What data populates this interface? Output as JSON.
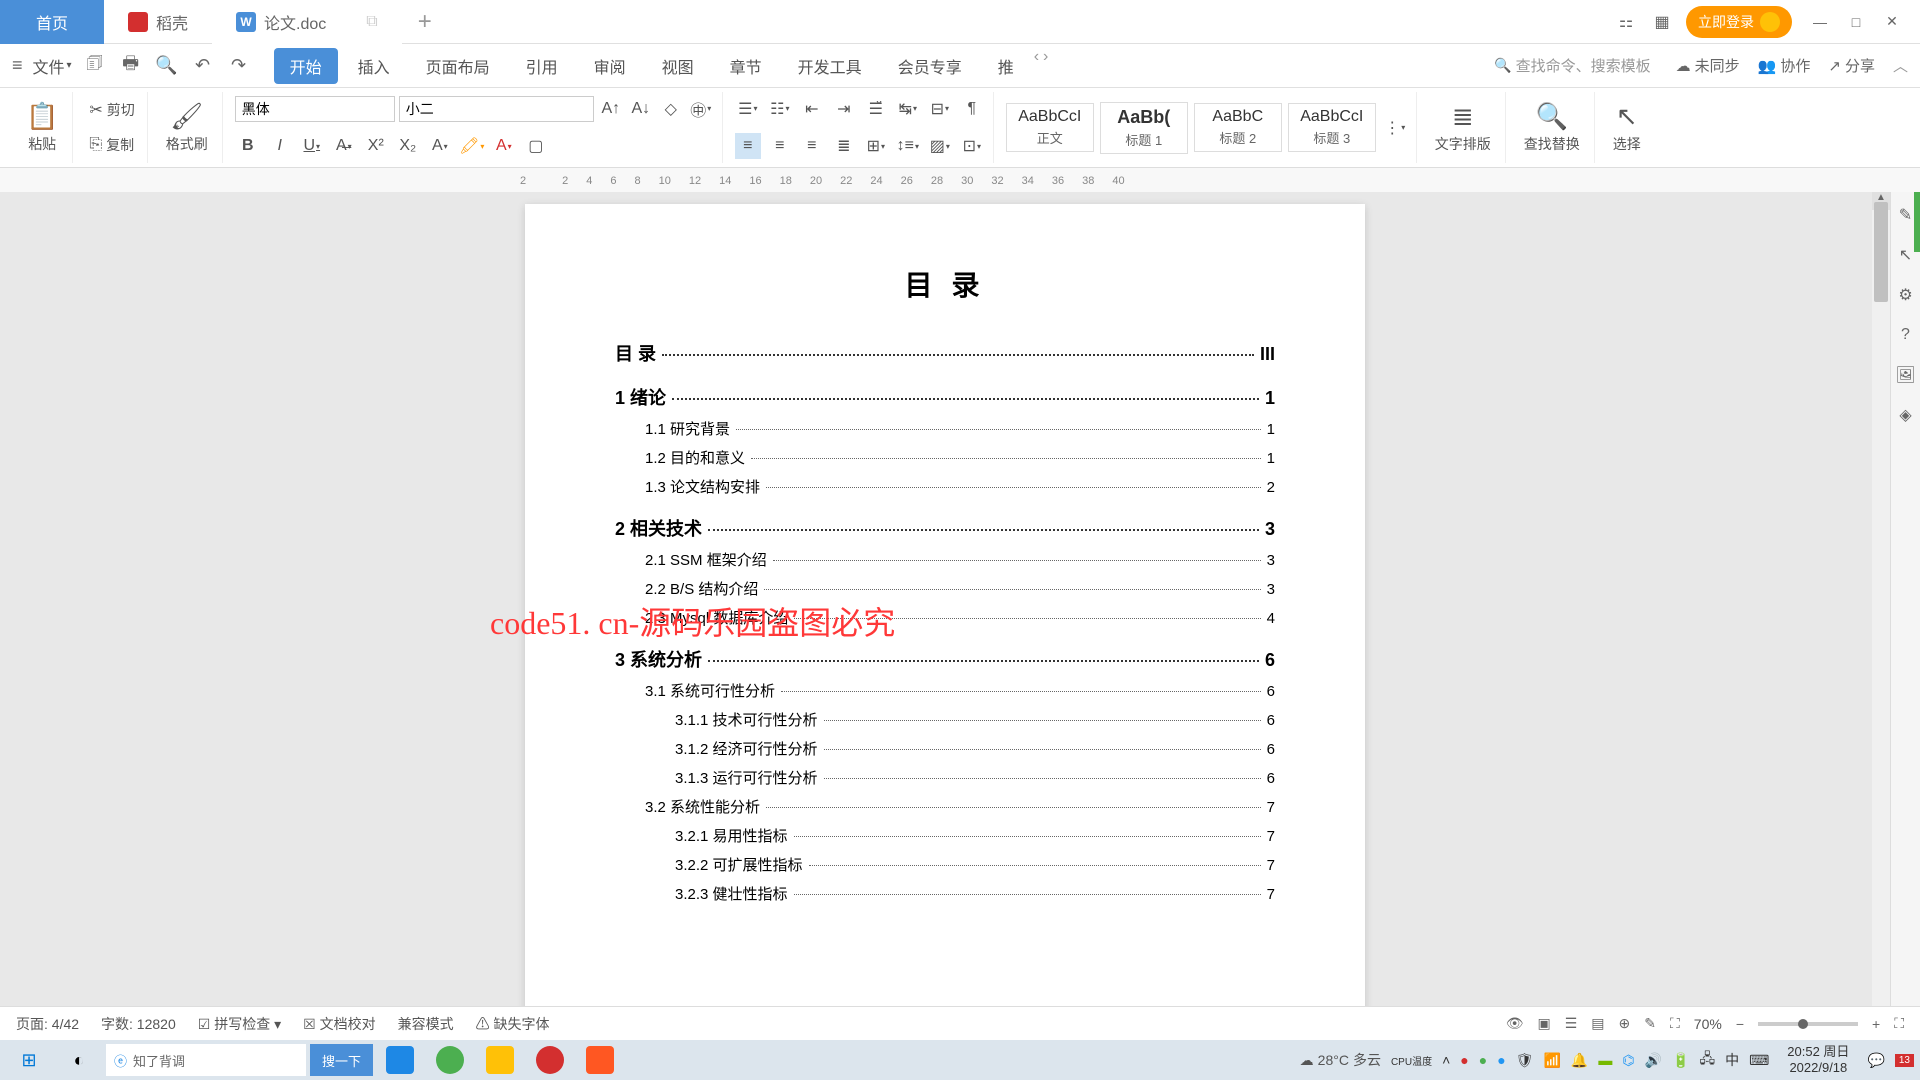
{
  "tabs": {
    "home": "首页",
    "daoke": "稻壳",
    "doc": "论文.doc"
  },
  "login_btn": "立即登录",
  "file_menu": "文件",
  "qat": {
    "save": "💾",
    "print": "🖨",
    "preview": "🔍",
    "undo": "↶",
    "redo": "↷"
  },
  "menu": [
    "开始",
    "插入",
    "页面布局",
    "引用",
    "审阅",
    "视图",
    "章节",
    "开发工具",
    "会员专享",
    "推"
  ],
  "search_cmd": "查找命令、搜索模板",
  "menu_right": {
    "sync": "未同步",
    "collab": "协作",
    "share": "分享"
  },
  "ribbon": {
    "paste": "粘贴",
    "cut": "剪切",
    "copy": "复制",
    "format_painter": "格式刷",
    "font_name": "黑体",
    "font_size": "小二",
    "styles": [
      {
        "preview": "AaBbCcI",
        "label": "正文"
      },
      {
        "preview": "AaBb(",
        "label": "标题 1"
      },
      {
        "preview": "AaBbC",
        "label": "标题 2"
      },
      {
        "preview": "AaBbCcI",
        "label": "标题 3"
      }
    ],
    "text_layout": "文字排版",
    "find_replace": "查找替换",
    "select": "选择"
  },
  "ruler_marks": [
    "2",
    "",
    "2",
    "4",
    "6",
    "8",
    "10",
    "12",
    "14",
    "16",
    "18",
    "20",
    "22",
    "24",
    "26",
    "28",
    "30",
    "32",
    "34",
    "36",
    "38",
    "40"
  ],
  "document": {
    "title": "目 录",
    "toc": [
      {
        "level": 1,
        "label": "目 录",
        "page": "III"
      },
      {
        "level": 1,
        "label": "1 绪论",
        "page": "1"
      },
      {
        "level": 2,
        "label": "1.1 研究背景",
        "page": "1"
      },
      {
        "level": 2,
        "label": "1.2 目的和意义",
        "page": "1"
      },
      {
        "level": 2,
        "label": "1.3 论文结构安排",
        "page": "2"
      },
      {
        "level": 1,
        "label": "2 相关技术",
        "page": "3"
      },
      {
        "level": 2,
        "label": "2.1 SSM 框架介绍",
        "page": "3"
      },
      {
        "level": 2,
        "label": "2.2 B/S 结构介绍",
        "page": "3"
      },
      {
        "level": 2,
        "label": "2.3 Mysql 数据库介绍",
        "page": "4"
      },
      {
        "level": 1,
        "label": "3 系统分析",
        "page": "6"
      },
      {
        "level": 2,
        "label": "3.1 系统可行性分析",
        "page": "6"
      },
      {
        "level": 3,
        "label": "3.1.1 技术可行性分析",
        "page": "6"
      },
      {
        "level": 3,
        "label": "3.1.2 经济可行性分析",
        "page": "6"
      },
      {
        "level": 3,
        "label": "3.1.3 运行可行性分析",
        "page": "6"
      },
      {
        "level": 2,
        "label": "3.2 系统性能分析",
        "page": "7"
      },
      {
        "level": 3,
        "label": "3.2.1 易用性指标",
        "page": "7"
      },
      {
        "level": 3,
        "label": "3.2.2 可扩展性指标",
        "page": "7"
      },
      {
        "level": 3,
        "label": "3.2.3 健壮性指标",
        "page": "7"
      }
    ]
  },
  "watermark_text": "code51.cn",
  "red_watermark": "code51. cn-源码乐园盗图必究",
  "statusbar": {
    "page": "页面: 4/42",
    "words": "字数: 12820",
    "spell": "拼写检查",
    "doccheck": "文档校对",
    "compat": "兼容模式",
    "missing_font": "缺失字体",
    "zoom": "70%"
  },
  "taskbar": {
    "search_placeholder": "知了背调",
    "search_btn": "搜一下",
    "weather_temp": "28°C",
    "weather_desc": "多云",
    "cpu_temp": "CPU温度",
    "ime": "中",
    "time": "20:52 周日",
    "date": "2022/9/18",
    "notif_count": "13"
  }
}
